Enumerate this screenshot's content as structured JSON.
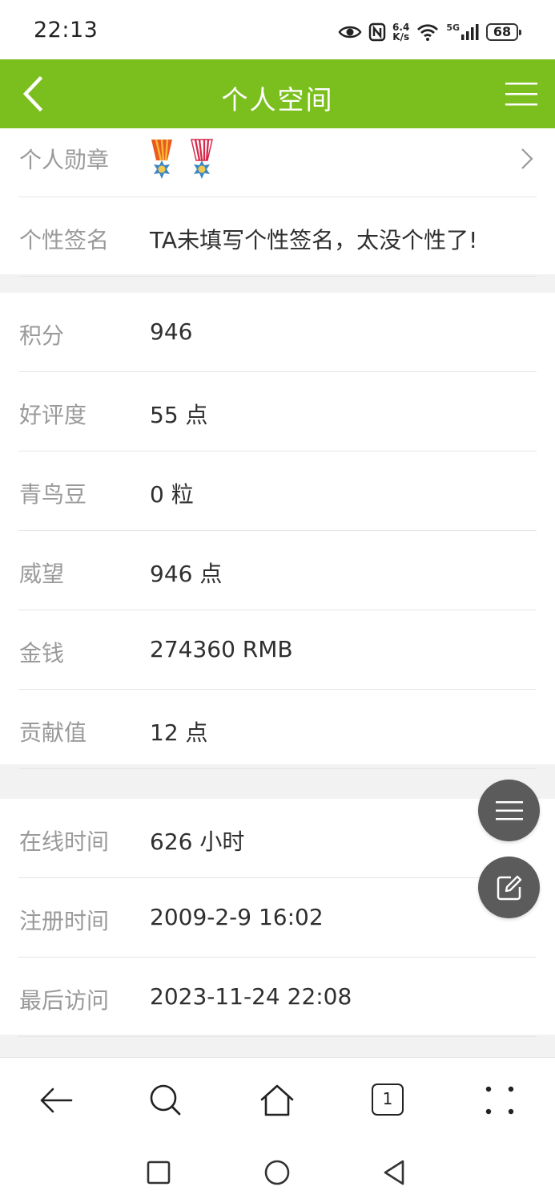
{
  "status_bar": {
    "time": "22:13",
    "net_speed_value": "6.4",
    "net_speed_unit": "K/s",
    "network": "5G",
    "battery": "68"
  },
  "header": {
    "title": "个人空间",
    "back_icon": "chevron-left-icon",
    "menu_icon": "hamburger-menu-icon",
    "background_color": "#7bbf1f"
  },
  "profile": {
    "medals_label": "个人勋章",
    "medals": [
      "medal-icon",
      "medal-icon"
    ],
    "signature_label": "个性签名",
    "signature_value": "TA未填写个性签名，太没个性了!"
  },
  "stats": [
    {
      "label": "积分",
      "value": "946"
    },
    {
      "label": "好评度",
      "value": "55 点"
    },
    {
      "label": "青鸟豆",
      "value": "0 粒"
    },
    {
      "label": "威望",
      "value": "946 点"
    },
    {
      "label": "金钱",
      "value": "274360 RMB"
    },
    {
      "label": "贡献值",
      "value": "12 点"
    }
  ],
  "activity": [
    {
      "label": "在线时间",
      "value": "626 小时"
    },
    {
      "label": "注册时间",
      "value": "2009-2-9 16:02"
    },
    {
      "label": "最后访问",
      "value": "2023-11-24 22:08"
    }
  ],
  "floating_buttons": [
    "menu-icon",
    "edit-icon"
  ],
  "browser_toolbar": {
    "tab_count": "1",
    "icons": [
      "back-arrow-icon",
      "search-icon",
      "home-icon",
      "tabs-icon",
      "more-icon"
    ]
  },
  "system_nav": [
    "recent-apps-icon",
    "home-circle-icon",
    "back-triangle-icon"
  ]
}
